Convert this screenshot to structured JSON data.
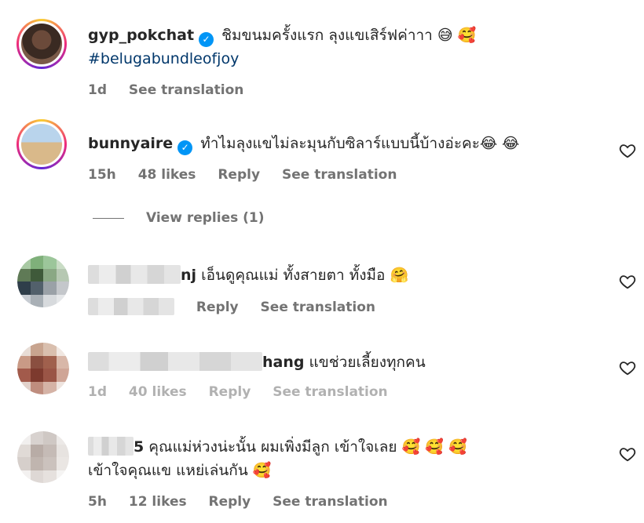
{
  "comments": [
    {
      "username": "gyp_pokchat",
      "text": "ชิมขนมครั้งแรก ลุงแขเสิร์ฟค่าาา 😅 🥰",
      "hashtag": "#belugabundleofjoy",
      "time": "1d",
      "likes": "",
      "reply_label": "",
      "translation_label": "See translation"
    },
    {
      "username": "bunnyaire",
      "text": "ทำไมลุงแขไม่ละมุนกับซิลาร์แบบนี้บ้างอ่ะคะ😂 😂",
      "time": "15h",
      "likes": "48 likes",
      "reply_label": "Reply",
      "translation_label": "See translation"
    },
    {
      "username_visible": "nj",
      "text": "เอ็นดูคุณแม่ ทั้งสายตา ทั้งมือ 🤗",
      "reply_label": "Reply",
      "translation_label": "See translation"
    },
    {
      "username_visible": "hang",
      "text": "แขช่วยเลี้ยงทุกคน",
      "time": "1d",
      "likes": "40 likes",
      "reply_label": "Reply",
      "translation_label": "See translation"
    },
    {
      "username_visible": "5",
      "text": "คุณแม่ห่วงน่ะนั้น ผมเพิ่งมีลูก เข้าใจเลย 🥰 🥰 🥰",
      "text_line2": "เข้าใจคุณแข แหย่เล่นกัน 🥰",
      "time": "5h",
      "likes": "12 likes",
      "reply_label": "Reply",
      "translation_label": "See translation"
    }
  ],
  "view_replies": "View replies (1)",
  "icons": {
    "heart": "heart-icon",
    "verified": "verified-badge-icon"
  },
  "colors": {
    "verified": "#0095f6",
    "meta": "#737373",
    "hashtag": "#00376b"
  }
}
